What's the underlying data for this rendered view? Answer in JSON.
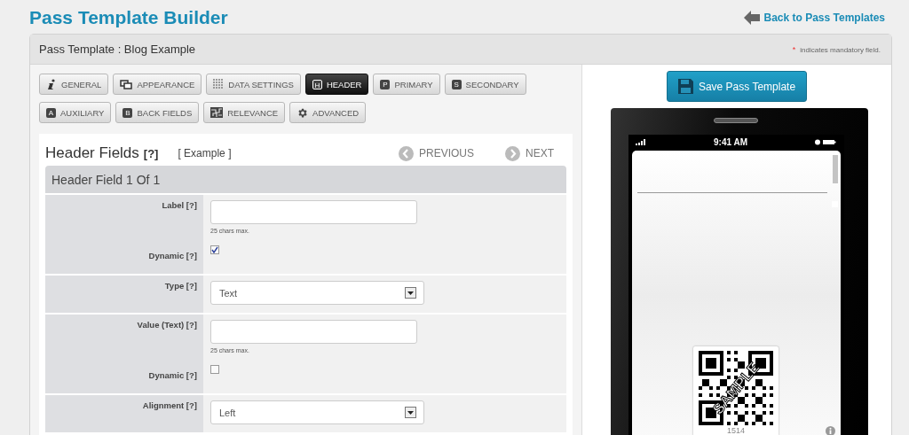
{
  "page": {
    "title": "Pass Template Builder",
    "back_link": "Back to Pass Templates"
  },
  "panel": {
    "title": "Pass Template : Blog Example",
    "mandatory_mark": "*",
    "mandatory_note": "indicates mandatory field."
  },
  "tabs": [
    {
      "label": "GENERAL",
      "kind": "info",
      "selected": false
    },
    {
      "label": "APPEARANCE",
      "kind": "windows",
      "selected": false
    },
    {
      "label": "DATA SETTINGS",
      "kind": "grid",
      "selected": false
    },
    {
      "label": "HEADER",
      "kind": "letter",
      "badge": "H",
      "selected": true
    },
    {
      "label": "PRIMARY",
      "kind": "letter",
      "badge": "P",
      "selected": false
    },
    {
      "label": "SECONDARY",
      "kind": "letter",
      "badge": "S",
      "selected": false
    },
    {
      "label": "AUXILIARY",
      "kind": "letter",
      "badge": "A",
      "selected": false
    },
    {
      "label": "BACK FIELDS",
      "kind": "letter",
      "badge": "B",
      "selected": false
    },
    {
      "label": "RELEVANCE",
      "kind": "map",
      "selected": false
    },
    {
      "label": "ADVANCED",
      "kind": "gear",
      "selected": false
    }
  ],
  "section": {
    "title": "Header Fields",
    "help": "[?]",
    "example": "[ Example ]",
    "previous": "PREVIOUS",
    "next": "NEXT",
    "subtitle": "Header Field 1 Of 1"
  },
  "rows": [
    {
      "fields": [
        {
          "kind": "text",
          "label": "Label",
          "help": "[?]",
          "hint": "25 chars max."
        },
        {
          "kind": "checkbox",
          "label": "Dynamic",
          "help": "[?]",
          "checked": true
        }
      ]
    },
    {
      "fields": [
        {
          "kind": "select",
          "label": "Type",
          "help": "[?]",
          "value": "Text"
        }
      ]
    },
    {
      "fields": [
        {
          "kind": "text",
          "label": "Value (Text)",
          "help": "[?]",
          "hint": "25 chars max."
        },
        {
          "kind": "checkbox",
          "label": "Dynamic",
          "help": "[?]",
          "checked": false
        }
      ]
    },
    {
      "fields": [
        {
          "kind": "select",
          "label": "Alignment",
          "help": "[?]",
          "value": "Left"
        }
      ]
    }
  ],
  "preview": {
    "save_button": "Save Pass Template",
    "time": "9:41 AM",
    "qr_overlay": "SAMPLE",
    "qr_number": "1514"
  }
}
